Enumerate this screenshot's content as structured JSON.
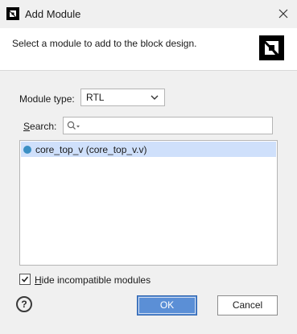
{
  "window": {
    "title": "Add Module",
    "app_icon": "amd-logo-icon",
    "close_icon": "close-icon"
  },
  "header": {
    "description": "Select a module to add to the block design.",
    "logo": "amd-logo-icon"
  },
  "form": {
    "module_type": {
      "label": "Module type:",
      "value": "RTL"
    },
    "search": {
      "label_mnemonic": "S",
      "label_rest": "earch:",
      "placeholder": "",
      "icon": "search-icon"
    },
    "modules": [
      {
        "label": "core_top_v (core_top_v.v)",
        "selected": true,
        "icon": "dot-icon"
      }
    ],
    "hide_incompatible": {
      "label_mnemonic": "H",
      "label_rest": "ide incompatible modules",
      "checked": true
    }
  },
  "footer": {
    "help_label": "?",
    "ok_label": "OK",
    "cancel_label": "Cancel"
  },
  "colors": {
    "accent": "#5b8fd6",
    "selection": "#cfe0fb",
    "dot": "#3b8fc4"
  }
}
